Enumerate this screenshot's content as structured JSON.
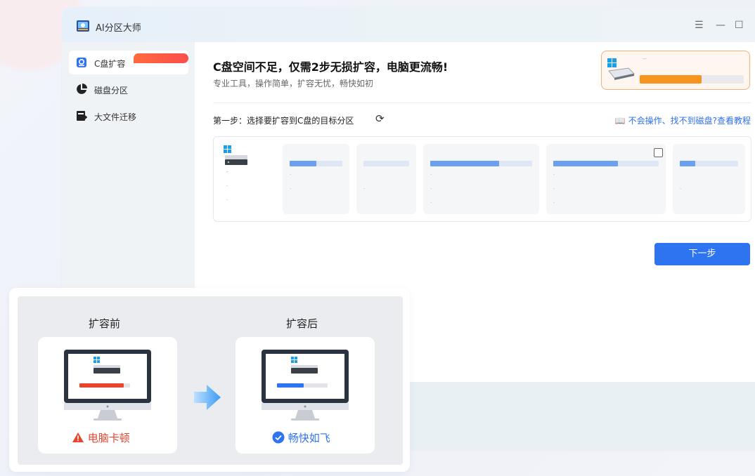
{
  "app": {
    "title": "AI分区大师"
  },
  "window_controls": {
    "menu": "☰",
    "minimize": "—",
    "maximize": "☐"
  },
  "sidebar": {
    "items": [
      {
        "label": "C盘扩容",
        "icon": "disk-expand-icon",
        "active": true
      },
      {
        "label": "磁盘分区",
        "icon": "pie-partition-icon"
      },
      {
        "label": "大文件迁移",
        "icon": "file-migrate-icon"
      }
    ]
  },
  "main": {
    "headline": "C盘空间不足，仅需2步无损扩容，电脑更流畅!",
    "subtitle": "专业工具，操作简单，扩容无忧，畅快如初",
    "promo": {
      "label": "--",
      "progress": 0.6
    },
    "step1": "第一步：选择要扩容到C盘的目标分区",
    "help_link": "不会操作、找不到磁盘?查看教程",
    "next_button": "下一步",
    "partitions": [
      {
        "fill": 0.5
      },
      {
        "fill": 0.0
      },
      {
        "fill": 0.68
      },
      {
        "fill": 0.62,
        "checkbox": true
      },
      {
        "fill": 0.27
      }
    ]
  },
  "comparison": {
    "before": {
      "title": "扩容前",
      "status": "电脑卡顿",
      "color": "#e8452f"
    },
    "after": {
      "title": "扩容后",
      "status": "畅快如飞",
      "color": "#2e74f0"
    }
  },
  "colors": {
    "accent": "#2e74f0",
    "warning": "#e8452f",
    "orange": "#f7941d"
  }
}
